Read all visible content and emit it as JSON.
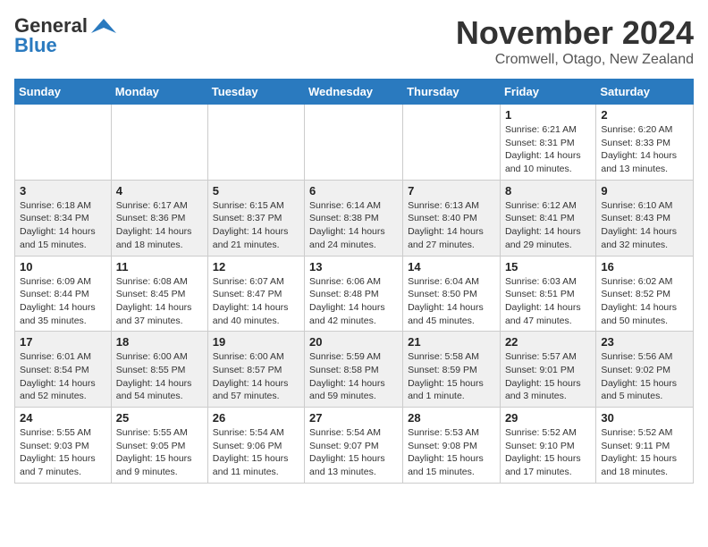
{
  "logo": {
    "general": "General",
    "blue": "Blue"
  },
  "title": "November 2024",
  "location": "Cromwell, Otago, New Zealand",
  "headers": [
    "Sunday",
    "Monday",
    "Tuesday",
    "Wednesday",
    "Thursday",
    "Friday",
    "Saturday"
  ],
  "weeks": [
    [
      {
        "day": "",
        "info": ""
      },
      {
        "day": "",
        "info": ""
      },
      {
        "day": "",
        "info": ""
      },
      {
        "day": "",
        "info": ""
      },
      {
        "day": "",
        "info": ""
      },
      {
        "day": "1",
        "info": "Sunrise: 6:21 AM\nSunset: 8:31 PM\nDaylight: 14 hours\nand 10 minutes."
      },
      {
        "day": "2",
        "info": "Sunrise: 6:20 AM\nSunset: 8:33 PM\nDaylight: 14 hours\nand 13 minutes."
      }
    ],
    [
      {
        "day": "3",
        "info": "Sunrise: 6:18 AM\nSunset: 8:34 PM\nDaylight: 14 hours\nand 15 minutes."
      },
      {
        "day": "4",
        "info": "Sunrise: 6:17 AM\nSunset: 8:36 PM\nDaylight: 14 hours\nand 18 minutes."
      },
      {
        "day": "5",
        "info": "Sunrise: 6:15 AM\nSunset: 8:37 PM\nDaylight: 14 hours\nand 21 minutes."
      },
      {
        "day": "6",
        "info": "Sunrise: 6:14 AM\nSunset: 8:38 PM\nDaylight: 14 hours\nand 24 minutes."
      },
      {
        "day": "7",
        "info": "Sunrise: 6:13 AM\nSunset: 8:40 PM\nDaylight: 14 hours\nand 27 minutes."
      },
      {
        "day": "8",
        "info": "Sunrise: 6:12 AM\nSunset: 8:41 PM\nDaylight: 14 hours\nand 29 minutes."
      },
      {
        "day": "9",
        "info": "Sunrise: 6:10 AM\nSunset: 8:43 PM\nDaylight: 14 hours\nand 32 minutes."
      }
    ],
    [
      {
        "day": "10",
        "info": "Sunrise: 6:09 AM\nSunset: 8:44 PM\nDaylight: 14 hours\nand 35 minutes."
      },
      {
        "day": "11",
        "info": "Sunrise: 6:08 AM\nSunset: 8:45 PM\nDaylight: 14 hours\nand 37 minutes."
      },
      {
        "day": "12",
        "info": "Sunrise: 6:07 AM\nSunset: 8:47 PM\nDaylight: 14 hours\nand 40 minutes."
      },
      {
        "day": "13",
        "info": "Sunrise: 6:06 AM\nSunset: 8:48 PM\nDaylight: 14 hours\nand 42 minutes."
      },
      {
        "day": "14",
        "info": "Sunrise: 6:04 AM\nSunset: 8:50 PM\nDaylight: 14 hours\nand 45 minutes."
      },
      {
        "day": "15",
        "info": "Sunrise: 6:03 AM\nSunset: 8:51 PM\nDaylight: 14 hours\nand 47 minutes."
      },
      {
        "day": "16",
        "info": "Sunrise: 6:02 AM\nSunset: 8:52 PM\nDaylight: 14 hours\nand 50 minutes."
      }
    ],
    [
      {
        "day": "17",
        "info": "Sunrise: 6:01 AM\nSunset: 8:54 PM\nDaylight: 14 hours\nand 52 minutes."
      },
      {
        "day": "18",
        "info": "Sunrise: 6:00 AM\nSunset: 8:55 PM\nDaylight: 14 hours\nand 54 minutes."
      },
      {
        "day": "19",
        "info": "Sunrise: 6:00 AM\nSunset: 8:57 PM\nDaylight: 14 hours\nand 57 minutes."
      },
      {
        "day": "20",
        "info": "Sunrise: 5:59 AM\nSunset: 8:58 PM\nDaylight: 14 hours\nand 59 minutes."
      },
      {
        "day": "21",
        "info": "Sunrise: 5:58 AM\nSunset: 8:59 PM\nDaylight: 15 hours\nand 1 minute."
      },
      {
        "day": "22",
        "info": "Sunrise: 5:57 AM\nSunset: 9:01 PM\nDaylight: 15 hours\nand 3 minutes."
      },
      {
        "day": "23",
        "info": "Sunrise: 5:56 AM\nSunset: 9:02 PM\nDaylight: 15 hours\nand 5 minutes."
      }
    ],
    [
      {
        "day": "24",
        "info": "Sunrise: 5:55 AM\nSunset: 9:03 PM\nDaylight: 15 hours\nand 7 minutes."
      },
      {
        "day": "25",
        "info": "Sunrise: 5:55 AM\nSunset: 9:05 PM\nDaylight: 15 hours\nand 9 minutes."
      },
      {
        "day": "26",
        "info": "Sunrise: 5:54 AM\nSunset: 9:06 PM\nDaylight: 15 hours\nand 11 minutes."
      },
      {
        "day": "27",
        "info": "Sunrise: 5:54 AM\nSunset: 9:07 PM\nDaylight: 15 hours\nand 13 minutes."
      },
      {
        "day": "28",
        "info": "Sunrise: 5:53 AM\nSunset: 9:08 PM\nDaylight: 15 hours\nand 15 minutes."
      },
      {
        "day": "29",
        "info": "Sunrise: 5:52 AM\nSunset: 9:10 PM\nDaylight: 15 hours\nand 17 minutes."
      },
      {
        "day": "30",
        "info": "Sunrise: 5:52 AM\nSunset: 9:11 PM\nDaylight: 15 hours\nand 18 minutes."
      }
    ]
  ]
}
